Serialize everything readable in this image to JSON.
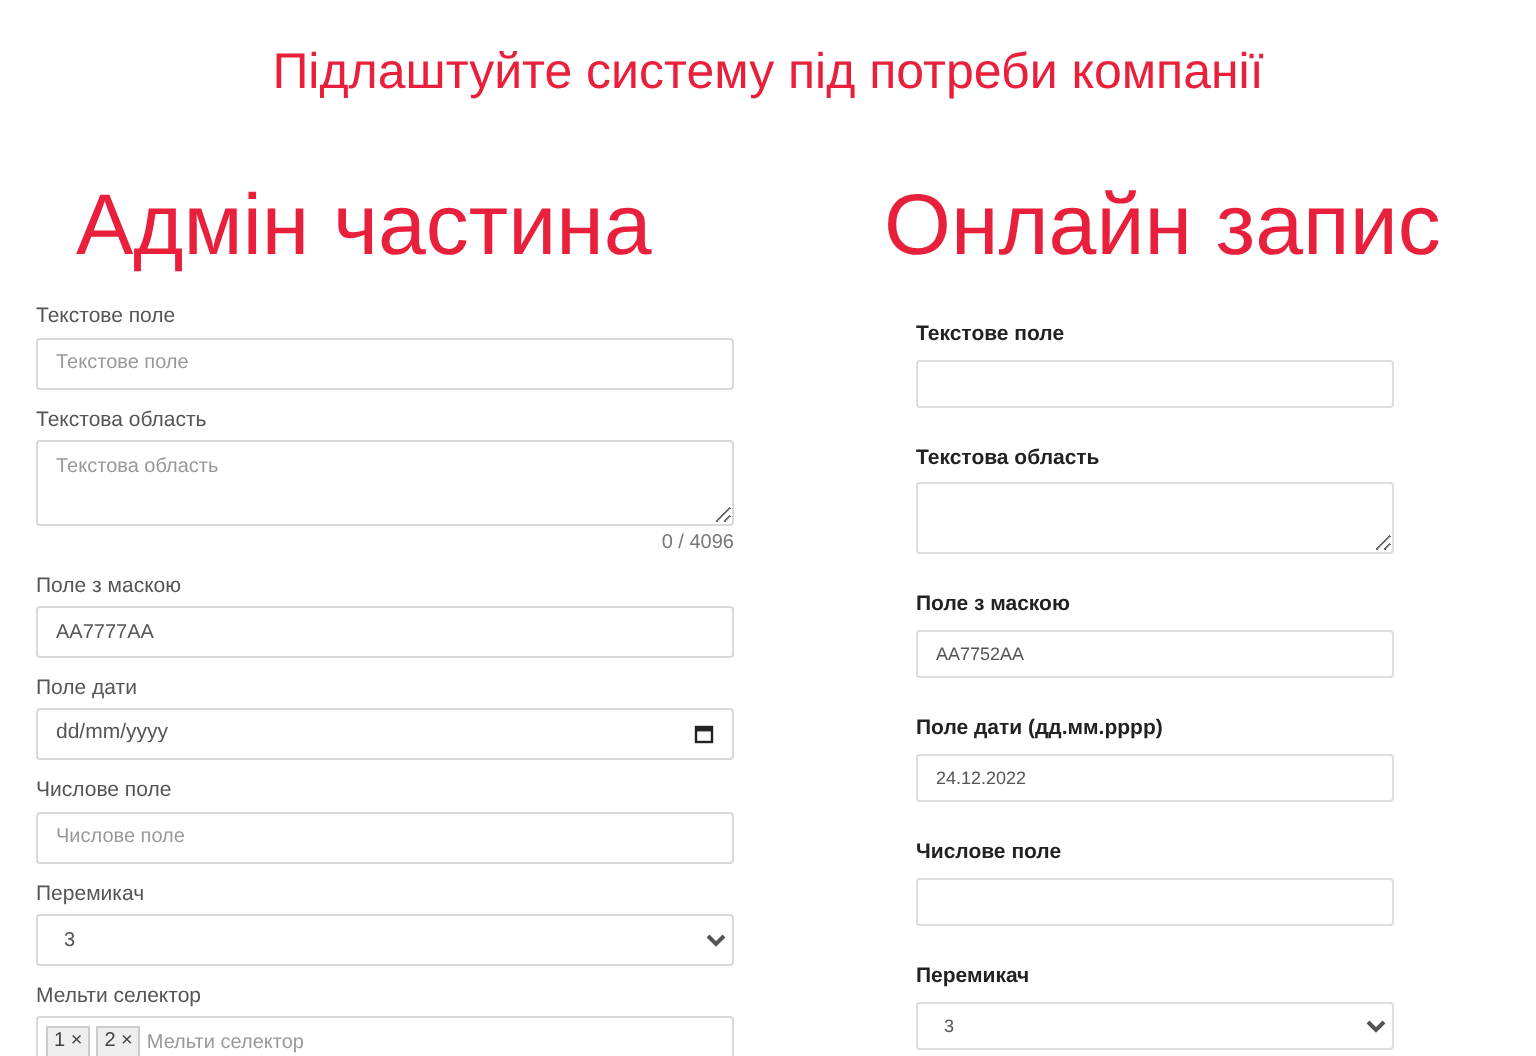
{
  "page_title": "Підлаштуйте систему під потреби компанії",
  "admin": {
    "heading": "Адмін частина",
    "fields": [
      {
        "kind": "text",
        "label": "Текстове поле",
        "placeholder": "Текстове поле"
      },
      {
        "kind": "textarea",
        "label": "Текстова область",
        "placeholder": "Текстова область",
        "counter": "0 / 4096"
      },
      {
        "kind": "text",
        "label": "Поле з маскою",
        "value": "AA7777AA"
      },
      {
        "kind": "date",
        "label": "Поле дати",
        "placeholder": "dd/mm/yyyy",
        "picker": true
      },
      {
        "kind": "number",
        "label": "Числове поле",
        "placeholder": "Числове поле"
      },
      {
        "kind": "select",
        "label": "Перемикач",
        "value": "3"
      },
      {
        "kind": "multiselect",
        "label": "Мельти селектор",
        "tags": [
          {
            "label": "1",
            "remove": "×"
          },
          {
            "label": "2",
            "remove": "×"
          }
        ],
        "placeholder": "Мельти селектор"
      }
    ]
  },
  "online": {
    "heading": "Онлайн запис",
    "fields": [
      {
        "kind": "text",
        "label": "Текстове поле"
      },
      {
        "kind": "textarea",
        "label": "Текстова область"
      },
      {
        "kind": "text",
        "label": "Поле з маскою",
        "value": "AA7752AA"
      },
      {
        "kind": "date",
        "label": "Поле дати (дд.мм.рррр)",
        "value": "24.12.2022",
        "picker": false
      },
      {
        "kind": "number",
        "label": "Числове поле"
      },
      {
        "kind": "select",
        "label": "Перемикач",
        "value": "3"
      }
    ]
  }
}
